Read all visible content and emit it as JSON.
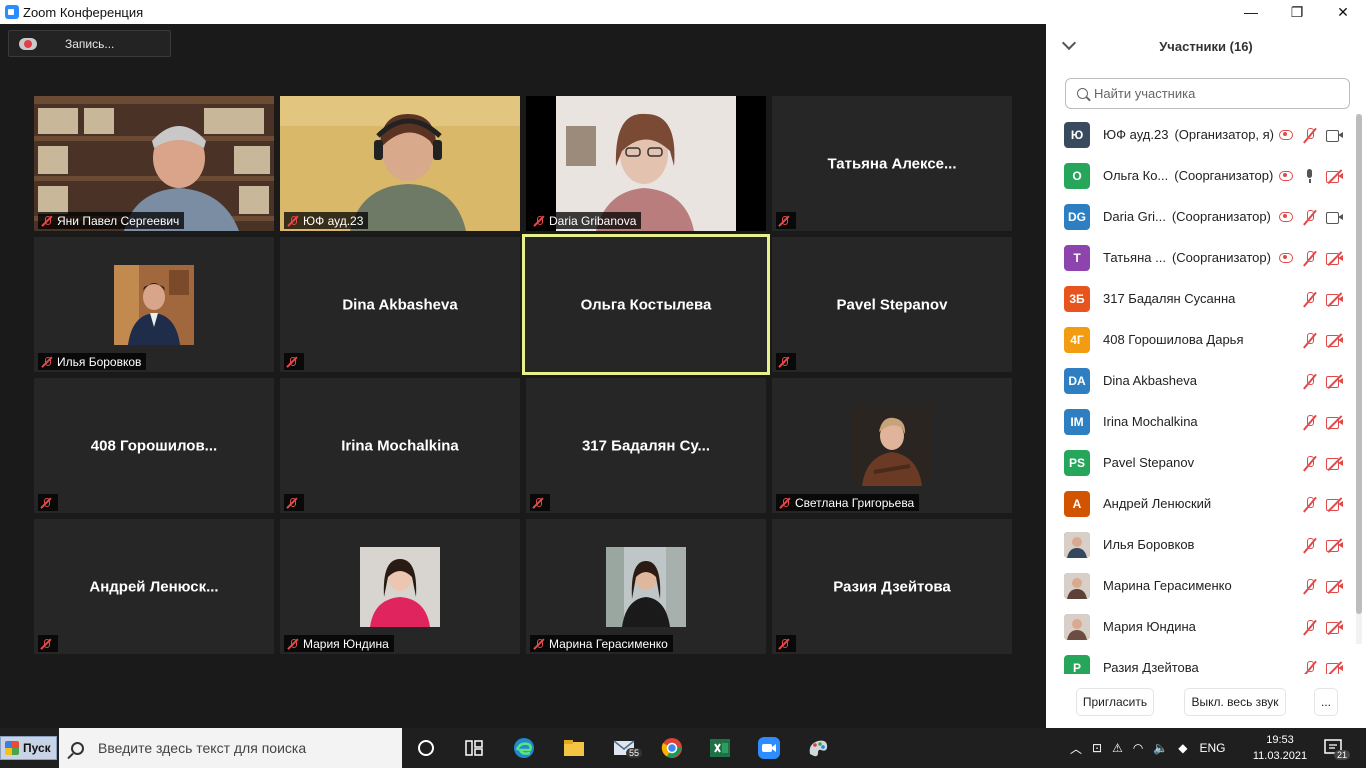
{
  "window": {
    "title": "Zoom Конференция",
    "controls": {
      "minimize": "—",
      "maximize": "❐",
      "close": "✕"
    }
  },
  "recording": {
    "label": "Запись..."
  },
  "tiles": [
    {
      "name": "Яни Павел Сергеевич",
      "video": true,
      "muted": true
    },
    {
      "name": "ЮФ ауд.23",
      "video": true,
      "muted": true
    },
    {
      "name": "Daria Gribanova",
      "video": true,
      "muted": true
    },
    {
      "name": "Татьяна  Алексе...",
      "video": false,
      "muted": true
    },
    {
      "name": "Илья Боровков",
      "video": "photo",
      "muted": true
    },
    {
      "name": "Dina Akbasheva",
      "video": false,
      "muted": true
    },
    {
      "name": "Ольга Костылева",
      "video": false,
      "muted": false,
      "active": true
    },
    {
      "name": "Pavel Stepanov",
      "video": false,
      "muted": true
    },
    {
      "name": "408  Горошилов...",
      "video": false,
      "muted": true
    },
    {
      "name": "Irina Mochalkina",
      "video": false,
      "muted": true
    },
    {
      "name": "317  Бадалян Су...",
      "video": false,
      "muted": true
    },
    {
      "name": "Светлана Григорьева",
      "video": "photo",
      "muted": true
    },
    {
      "name": "Андрей  Ленюск...",
      "video": false,
      "muted": true
    },
    {
      "name": "Мария Юндина",
      "video": "photo",
      "muted": true
    },
    {
      "name": "Марина Герасименко",
      "video": "photo",
      "muted": true
    },
    {
      "name": "Разия Дзейтова",
      "video": false,
      "muted": true
    }
  ],
  "panel": {
    "title": "Участники (16)",
    "search_placeholder": "Найти участника",
    "participants": [
      {
        "initials": "Ю",
        "color": "#3a4a5e",
        "name": "ЮФ ауд.23",
        "role": "(Организатор, я)",
        "rec": true,
        "mic": "muted",
        "cam": "on"
      },
      {
        "initials": "O",
        "color": "#26a65b",
        "name": "Ольга Ко...",
        "role": "(Соорганизатор)",
        "rec": true,
        "mic": "on",
        "cam": "muted"
      },
      {
        "initials": "DG",
        "color": "#2d7fc1",
        "name": "Daria Gri...",
        "role": "(Соорганизатор)",
        "rec": true,
        "mic": "muted",
        "cam": "on"
      },
      {
        "initials": "T",
        "color": "#8e44ad",
        "name": "Татьяна ...",
        "role": "(Соорганизатор)",
        "rec": true,
        "mic": "muted",
        "cam": "muted"
      },
      {
        "initials": "3Б",
        "color": "#e8541e",
        "name": "317 Бадалян Сусанна",
        "role": "",
        "rec": false,
        "mic": "muted",
        "cam": "muted"
      },
      {
        "initials": "4Г",
        "color": "#f39c12",
        "name": "408 Горошилова Дарья",
        "role": "",
        "rec": false,
        "mic": "muted",
        "cam": "muted"
      },
      {
        "initials": "DA",
        "color": "#2d7fc1",
        "name": "Dina Akbasheva",
        "role": "",
        "rec": false,
        "mic": "muted",
        "cam": "muted"
      },
      {
        "initials": "IM",
        "color": "#2d7fc1",
        "name": "Irina Mochalkina",
        "role": "",
        "rec": false,
        "mic": "muted",
        "cam": "muted"
      },
      {
        "initials": "PS",
        "color": "#26a65b",
        "name": "Pavel Stepanov",
        "role": "",
        "rec": false,
        "mic": "muted",
        "cam": "muted"
      },
      {
        "initials": "A",
        "color": "#d35400",
        "name": "Андрей Ленюский",
        "role": "",
        "rec": false,
        "mic": "muted",
        "cam": "muted"
      },
      {
        "initials": "",
        "color": "#34495e",
        "name": "Илья Боровков",
        "role": "",
        "rec": false,
        "mic": "muted",
        "cam": "muted",
        "photo": true
      },
      {
        "initials": "",
        "color": "#5d4037",
        "name": "Марина Герасименко",
        "role": "",
        "rec": false,
        "mic": "muted",
        "cam": "muted",
        "photo": true
      },
      {
        "initials": "",
        "color": "#6d4c41",
        "name": "Мария Юндина",
        "role": "",
        "rec": false,
        "mic": "muted",
        "cam": "muted",
        "photo": true
      },
      {
        "initials": "P",
        "color": "#26a65b",
        "name": "Разия Дзейтова",
        "role": "",
        "rec": false,
        "mic": "muted",
        "cam": "muted"
      }
    ],
    "footer": {
      "invite": "Пригласить",
      "mute_all": "Выкл. весь звук",
      "more": "..."
    }
  },
  "taskbar": {
    "start_label": "Пуск",
    "search_placeholder": "Введите здесь текст для поиска",
    "mail_badge": "55",
    "lang": "ENG",
    "time": "19:53",
    "date": "11.03.2021",
    "notif_count": "21"
  }
}
